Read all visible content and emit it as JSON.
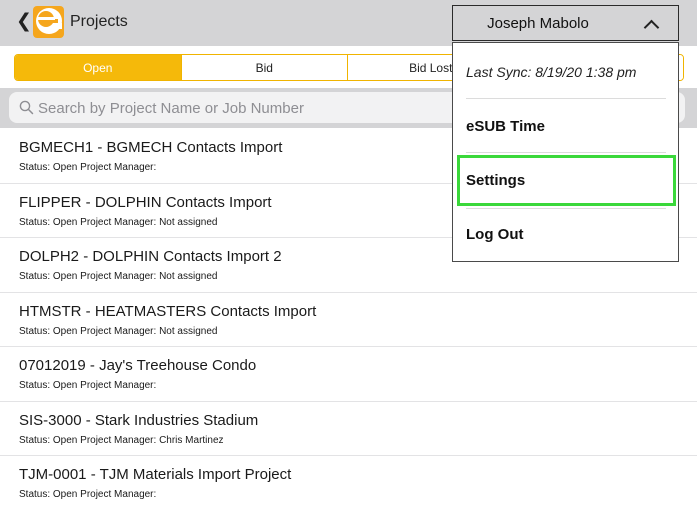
{
  "header": {
    "back_glyph": "❮",
    "title": "Projects",
    "logo_icon": "esub-logo",
    "user_name": "Joseph Mabolo"
  },
  "tabs": [
    {
      "label": "Open",
      "active": true
    },
    {
      "label": "Bid",
      "active": false
    },
    {
      "label": "Bid Lost",
      "active": false
    },
    {
      "label": "",
      "active": false
    }
  ],
  "search": {
    "placeholder": "Search by Project Name or Job Number"
  },
  "projects": [
    {
      "name": "BGMECH1 - BGMECH Contacts Import",
      "status": "Status: Open Project Manager:"
    },
    {
      "name": "FLIPPER - DOLPHIN Contacts Import",
      "status": "Status: Open Project Manager: Not assigned"
    },
    {
      "name": "DOLPH2 - DOLPHIN Contacts Import 2",
      "status": "Status: Open Project Manager: Not assigned"
    },
    {
      "name": "HTMSTR - HEATMASTERS Contacts Import",
      "status": "Status: Open Project Manager: Not assigned"
    },
    {
      "name": "07012019 - Jay's Treehouse Condo",
      "status": "Status: Open Project Manager:"
    },
    {
      "name": "SIS-3000 - Stark Industries Stadium",
      "status": "Status: Open Project Manager: Chris Martinez"
    },
    {
      "name": "TJM-0001 - TJM Materials Import Project",
      "status": "Status: Open Project Manager:"
    }
  ],
  "menu": {
    "last_sync": "Last Sync: 8/19/20 1:38 pm",
    "items": [
      "eSUB Time",
      "Settings",
      "Log Out"
    ],
    "highlighted_item": "Settings",
    "highlight_color": "#3ad83a"
  },
  "colors": {
    "accent": "#f5b90a",
    "header_bg": "#d4d4d6"
  }
}
